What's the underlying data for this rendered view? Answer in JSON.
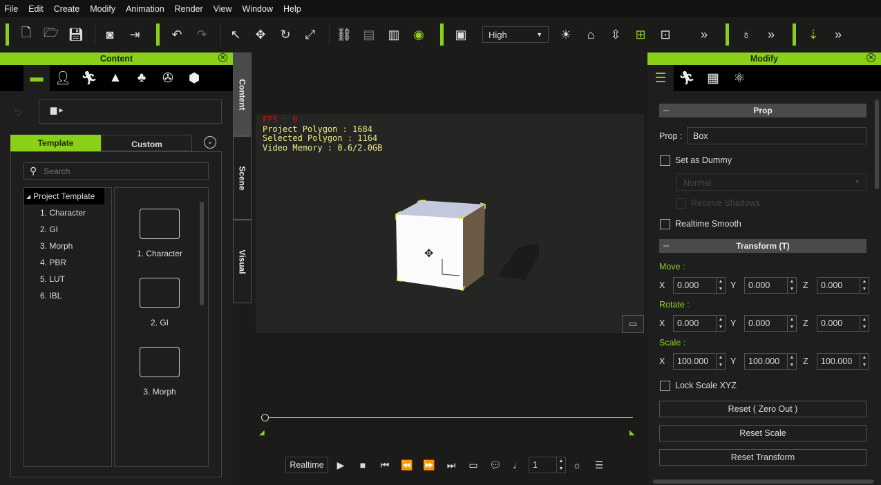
{
  "menu": [
    "File",
    "Edit",
    "Create",
    "Modify",
    "Animation",
    "Render",
    "View",
    "Window",
    "Help"
  ],
  "toolbar": {
    "quality": "High",
    "accent": "#8ad01a"
  },
  "content_panel": {
    "title": "Content",
    "tabs": [
      "Template",
      "Custom"
    ],
    "search_placeholder": "Search",
    "tree_root": "Project Template",
    "tree_items": [
      "1. Character",
      "2. GI",
      "3. Morph",
      "4. PBR",
      "5. LUT",
      "6. IBL"
    ],
    "folders": [
      "1. Character",
      "2. GI",
      "3. Morph"
    ]
  },
  "side_tabs": [
    "Content",
    "Scene",
    "Visual"
  ],
  "viewport": {
    "fps": "FPS : 0",
    "project_polygon": "Project Polygon : 1684",
    "selected_polygon": "Selected Polygon : 1164",
    "video_memory": "Video Memory : 0.6/2.0GB"
  },
  "playback": {
    "mode": "Realtime",
    "frame": "1"
  },
  "modify_panel": {
    "title": "Modify",
    "prop_section": "Prop",
    "prop_label": "Prop :",
    "prop_value": "Box",
    "set_as_dummy": "Set as Dummy",
    "shadow_mode": "Normal",
    "receive_shadows": "Receive Shadows",
    "realtime_smooth": "Realtime Smooth",
    "transform_section": "Transform  (T)",
    "move_label": "Move :",
    "rotate_label": "Rotate :",
    "scale_label": "Scale :",
    "axes": [
      "X",
      "Y",
      "Z"
    ],
    "move": [
      "0.000",
      "0.000",
      "0.000"
    ],
    "rotate": [
      "0.000",
      "0.000",
      "0.000"
    ],
    "scale": [
      "100.000",
      "100.000",
      "100.000"
    ],
    "lock_scale": "Lock Scale XYZ",
    "buttons": [
      "Reset ( Zero Out )",
      "Reset Scale",
      "Reset Transform"
    ]
  }
}
